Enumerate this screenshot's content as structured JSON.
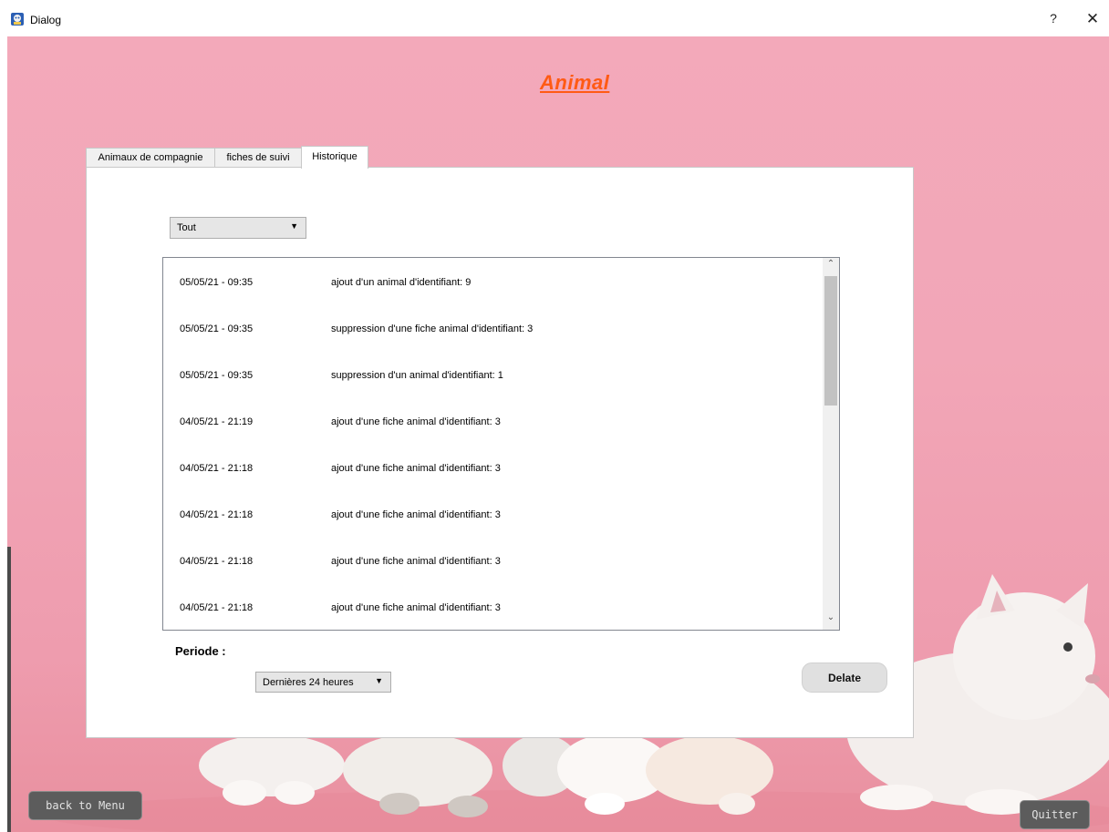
{
  "window": {
    "title": "Dialog",
    "help_label": "?",
    "close_label": "✕"
  },
  "heading": "Animal",
  "tabs": [
    {
      "label": "Animaux de compagnie"
    },
    {
      "label": "fiches de suivi"
    },
    {
      "label": "Historique"
    }
  ],
  "active_tab": "Historique",
  "filter_combo": {
    "value": "Tout"
  },
  "history": [
    {
      "date": "05/05/21  -  09:35",
      "message": "ajout d'un animal d'identifiant:  9"
    },
    {
      "date": "05/05/21  -  09:35",
      "message": "suppression d'une fiche animal  d'identifiant:  3"
    },
    {
      "date": "05/05/21  -  09:35",
      "message": "suppression d'un animal d'identifiant:  1"
    },
    {
      "date": "04/05/21  -  21:19",
      "message": "ajout d'une fiche animal d'identifiant:  3"
    },
    {
      "date": "04/05/21  -  21:18",
      "message": "ajout d'une fiche animal d'identifiant:  3"
    },
    {
      "date": "04/05/21  -  21:18",
      "message": "ajout d'une fiche animal d'identifiant:  3"
    },
    {
      "date": "04/05/21  -  21:18",
      "message": "ajout d'une fiche animal d'identifiant:  3"
    },
    {
      "date": "04/05/21  -  21:18",
      "message": "ajout d'une fiche animal d'identifiant:  3"
    }
  ],
  "periode": {
    "label": "Periode :",
    "value": "Dernières 24 heures"
  },
  "buttons": {
    "delete": "Delate",
    "back": "back to Menu",
    "quit": "Quitter"
  },
  "colors": {
    "background": "#f3a9ba",
    "heading": "#ff5a14",
    "dark_button": "#5c5c5c"
  },
  "icons": {
    "app": "dialog-app-icon",
    "combo_arrow": "dropdown-arrow-icon",
    "scroll_up": "scroll-up-icon",
    "scroll_down": "scroll-down-icon"
  }
}
